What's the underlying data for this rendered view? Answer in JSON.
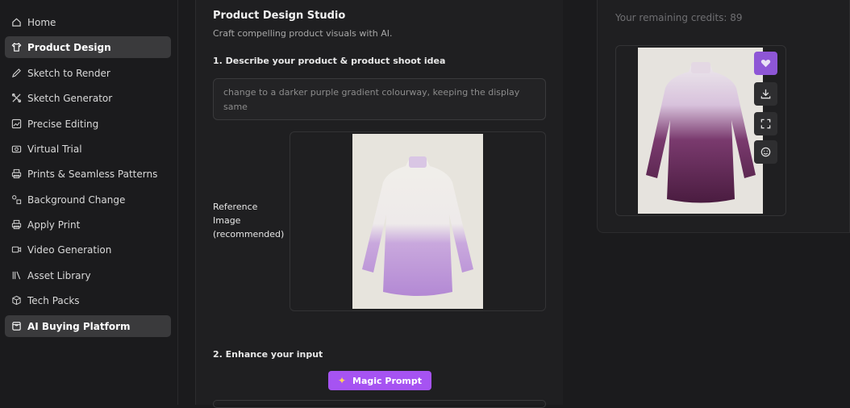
{
  "sidebar": {
    "items": [
      {
        "label": "Home",
        "icon": "home-icon"
      },
      {
        "label": "Product Design",
        "icon": "shirt-icon",
        "active": true
      },
      {
        "label": "Sketch to Render",
        "icon": "pencil-icon"
      },
      {
        "label": "Sketch Generator",
        "icon": "tools-icon"
      },
      {
        "label": "Precise Editing",
        "icon": "image-edit-icon"
      },
      {
        "label": "Virtual Trial",
        "icon": "camera-icon"
      },
      {
        "label": "Prints & Seamless Patterns",
        "icon": "printer-icon"
      },
      {
        "label": "Background Change",
        "icon": "shapes-icon"
      },
      {
        "label": "Apply Print",
        "icon": "printer-icon"
      },
      {
        "label": "Video Generation",
        "icon": "video-icon"
      },
      {
        "label": "Asset Library",
        "icon": "library-icon"
      },
      {
        "label": "Tech Packs",
        "icon": "cube-icon"
      },
      {
        "label": "AI Buying Platform",
        "icon": "bag-icon",
        "active": true
      }
    ]
  },
  "main": {
    "title": "Product Design Studio",
    "subtitle": "Craft compelling product visuals with AI.",
    "step1_label": "1. Describe your product & product shoot idea",
    "prompt_value": "change to a darker purple gradient colourway, keeping the display same",
    "reference_label": "Reference Image (recommended)",
    "step2_label": "2. Enhance your input",
    "magic_button": "Magic Prompt"
  },
  "right": {
    "credits_text": "Your remaining credits: 89",
    "tools": [
      "heart-icon",
      "download-icon",
      "fullscreen-icon",
      "smiley-icon"
    ]
  },
  "colors": {
    "accent": "#a653f2",
    "favorite": "#8e56d6",
    "background": "#1b1b1d"
  }
}
